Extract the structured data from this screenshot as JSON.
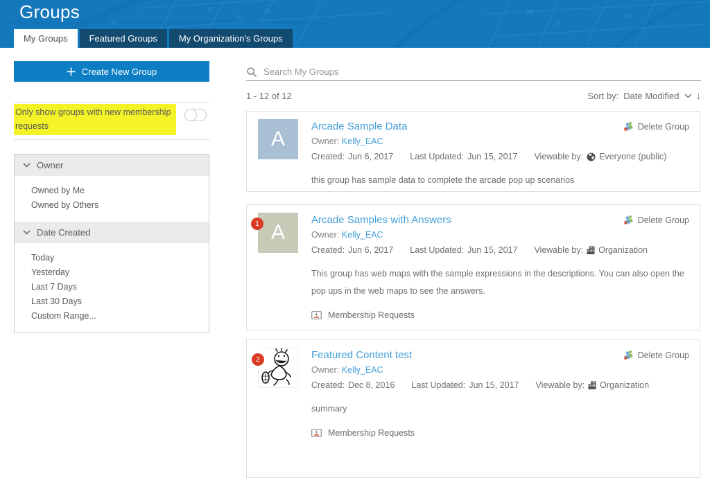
{
  "header": {
    "title": "Groups",
    "tabs": [
      {
        "label": "My Groups",
        "active": true
      },
      {
        "label": "Featured Groups",
        "active": false
      },
      {
        "label": "My Organization's Groups",
        "active": false
      }
    ]
  },
  "sidebar": {
    "create_button_label": "Create New Group",
    "toggle_label": "Only show groups with new membership requests",
    "toggle_state": "off",
    "filters": [
      {
        "title": "Owner",
        "items": [
          "Owned by Me",
          "Owned by Others"
        ]
      },
      {
        "title": "Date Created",
        "items": [
          "Today",
          "Yesterday",
          "Last 7 Days",
          "Last 30 Days",
          "Custom Range..."
        ]
      }
    ]
  },
  "main": {
    "search_placeholder": "Search My Groups",
    "result_count": "1 - 12 of 12",
    "sort_label": "Sort by:",
    "sort_value": "Date Modified",
    "cards": [
      {
        "thumb_letter": "A",
        "title": "Arcade Sample Data",
        "owner_label": "Owner:",
        "owner_name": "Kelly_EAC",
        "created_label": "Created:",
        "created_value": "Jun 6, 2017",
        "updated_label": "Last Updated:",
        "updated_value": "Jun 15, 2017",
        "viewable_label": "Viewable by:",
        "viewable_value": "Everyone (public)",
        "description": "this group has sample data to complete the arcade pop up scenarios",
        "delete_label": "Delete Group"
      },
      {
        "badge": "1",
        "thumb_letter": "A",
        "title": "Arcade Samples with Answers",
        "owner_label": "Owner:",
        "owner_name": "Kelly_EAC",
        "created_label": "Created:",
        "created_value": "Jun 6, 2017",
        "updated_label": "Last Updated:",
        "updated_value": "Jun 15, 2017",
        "viewable_label": "Viewable by:",
        "viewable_value": "Organization",
        "description": "This group has web maps with the sample expressions in the descriptions. You can also open the pop ups in the web maps to see the answers.",
        "membership_label": "Membership Requests",
        "delete_label": "Delete Group"
      },
      {
        "badge": "2",
        "title": "Featured Content test",
        "owner_label": "Owner:",
        "owner_name": "Kelly_EAC",
        "created_label": "Created:",
        "created_value": "Dec 8, 2016",
        "updated_label": "Last Updated:",
        "updated_value": "Jun 15, 2017",
        "viewable_label": "Viewable by:",
        "viewable_value": "Organization",
        "description": "summary",
        "membership_label": "Membership Requests",
        "delete_label": "Delete Group"
      }
    ]
  },
  "colors": {
    "header_blue": "#1478bd",
    "tab_inactive_blue": "#134a70",
    "button_blue": "#0d7ec4",
    "link_blue": "#45a0d8",
    "highlight_yellow": "#f4f327",
    "badge_red": "#d93b25",
    "thumb_blue": "#a9c0d4",
    "thumb_sage": "#c6cab6"
  }
}
